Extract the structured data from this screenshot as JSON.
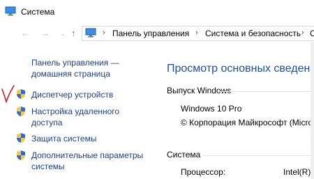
{
  "window": {
    "title": "Система"
  },
  "breadcrumb": {
    "items": [
      "Панель управления",
      "Система и безопасность",
      "С"
    ]
  },
  "sidebar": {
    "home_link_line1": "Панель управления —",
    "home_link_line2": "домашняя страница",
    "items": [
      {
        "label": "Диспетчер устройств"
      },
      {
        "label_line1": "Настройка удаленного",
        "label_line2": "доступа"
      },
      {
        "label": "Защита системы"
      },
      {
        "label_line1": "Дополнительные параметры",
        "label_line2": "системы"
      }
    ]
  },
  "main": {
    "heading": "Просмотр основных сведений",
    "edition_section": "Выпуск Windows",
    "edition_name": "Windows 10 Pro",
    "copyright": "© Корпорация Майкрософт (Micro",
    "system_section": "Система",
    "processor_label": "Процессор:",
    "processor_value": "Intel(R)"
  },
  "colors": {
    "link": "#1a3f8f",
    "heading": "#1e4d9e",
    "annotation": "#d11a1a"
  }
}
